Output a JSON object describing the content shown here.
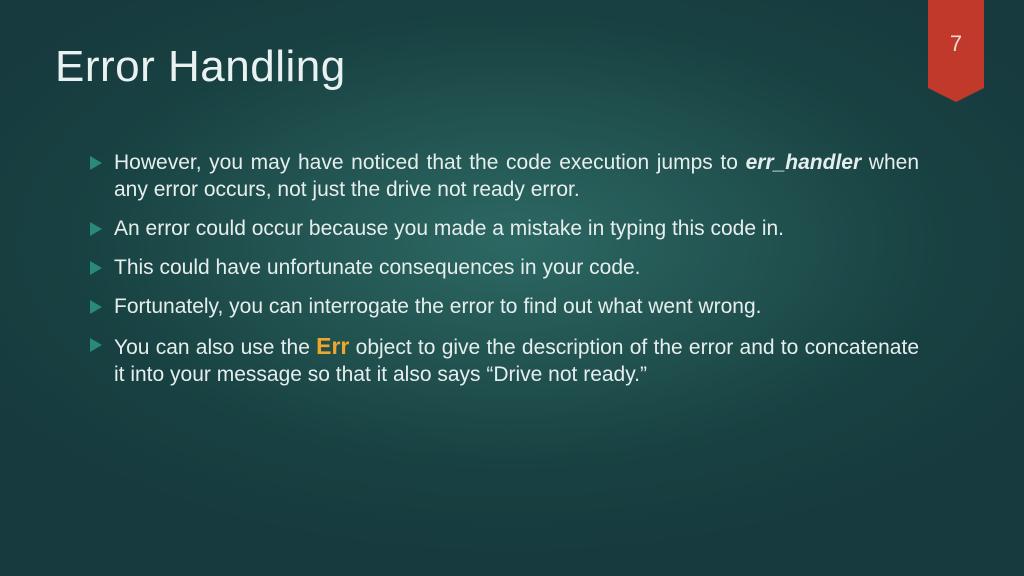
{
  "slide": {
    "title": "Error Handling",
    "number": "7",
    "bullets": {
      "b1_pre": "However, you may have noticed that the code execution jumps to ",
      "b1_em": "err_handler",
      "b1_post": " when any error occurs, not just the drive not ready error.",
      "b2": "An error could occur because you made a mistake in typing this code in.",
      "b3": "This could have unfortunate consequences in your code.",
      "b4": "Fortunately, you can interrogate the error to find out what went wrong.",
      "b5_pre": "You can also use the ",
      "b5_em": "Err",
      "b5_post": " object to give the description of the error and to concatenate it into your message so that it also says “Drive not ready.”"
    }
  }
}
